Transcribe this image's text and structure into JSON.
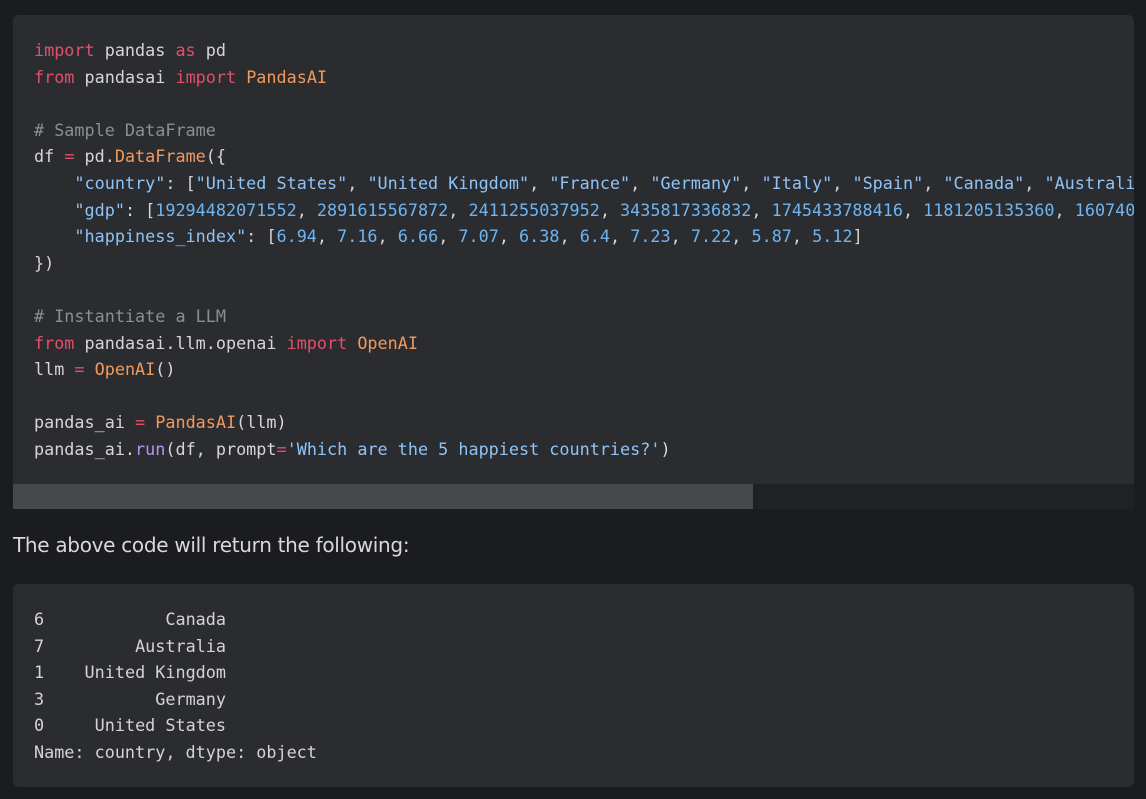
{
  "code": {
    "lines": [
      [
        {
          "t": "import",
          "c": "kw"
        },
        {
          "t": " pandas ",
          "c": "p"
        },
        {
          "t": "as",
          "c": "kw"
        },
        {
          "t": " pd",
          "c": "p"
        }
      ],
      [
        {
          "t": "from",
          "c": "kw"
        },
        {
          "t": " pandasai ",
          "c": "p"
        },
        {
          "t": "import",
          "c": "kw"
        },
        {
          "t": " ",
          "c": "p"
        },
        {
          "t": "PandasAI",
          "c": "cls"
        }
      ],
      [],
      [
        {
          "t": "# Sample DataFrame",
          "c": "com"
        }
      ],
      [
        {
          "t": "df ",
          "c": "p"
        },
        {
          "t": "=",
          "c": "op"
        },
        {
          "t": " pd.",
          "c": "p"
        },
        {
          "t": "DataFrame",
          "c": "cls"
        },
        {
          "t": "({",
          "c": "p"
        }
      ],
      [
        {
          "t": "    \"country\"",
          "c": "str"
        },
        {
          "t": ": [",
          "c": "p"
        },
        {
          "t": "\"United States\"",
          "c": "str"
        },
        {
          "t": ", ",
          "c": "p"
        },
        {
          "t": "\"United Kingdom\"",
          "c": "str"
        },
        {
          "t": ", ",
          "c": "p"
        },
        {
          "t": "\"France\"",
          "c": "str"
        },
        {
          "t": ", ",
          "c": "p"
        },
        {
          "t": "\"Germany\"",
          "c": "str"
        },
        {
          "t": ", ",
          "c": "p"
        },
        {
          "t": "\"Italy\"",
          "c": "str"
        },
        {
          "t": ", ",
          "c": "p"
        },
        {
          "t": "\"Spain\"",
          "c": "str"
        },
        {
          "t": ", ",
          "c": "p"
        },
        {
          "t": "\"Canada\"",
          "c": "str"
        },
        {
          "t": ", ",
          "c": "p"
        },
        {
          "t": "\"Australi",
          "c": "str"
        }
      ],
      [
        {
          "t": "    \"gdp\"",
          "c": "str"
        },
        {
          "t": ": [",
          "c": "p"
        },
        {
          "t": "19294482071552",
          "c": "num"
        },
        {
          "t": ", ",
          "c": "p"
        },
        {
          "t": "2891615567872",
          "c": "num"
        },
        {
          "t": ", ",
          "c": "p"
        },
        {
          "t": "2411255037952",
          "c": "num"
        },
        {
          "t": ", ",
          "c": "p"
        },
        {
          "t": "3435817336832",
          "c": "num"
        },
        {
          "t": ", ",
          "c": "p"
        },
        {
          "t": "1745433788416",
          "c": "num"
        },
        {
          "t": ", ",
          "c": "p"
        },
        {
          "t": "1181205135360",
          "c": "num"
        },
        {
          "t": ", ",
          "c": "p"
        },
        {
          "t": "160740",
          "c": "num"
        }
      ],
      [
        {
          "t": "    \"happiness_index\"",
          "c": "str"
        },
        {
          "t": ": [",
          "c": "p"
        },
        {
          "t": "6.94",
          "c": "num"
        },
        {
          "t": ", ",
          "c": "p"
        },
        {
          "t": "7.16",
          "c": "num"
        },
        {
          "t": ", ",
          "c": "p"
        },
        {
          "t": "6.66",
          "c": "num"
        },
        {
          "t": ", ",
          "c": "p"
        },
        {
          "t": "7.07",
          "c": "num"
        },
        {
          "t": ", ",
          "c": "p"
        },
        {
          "t": "6.38",
          "c": "num"
        },
        {
          "t": ", ",
          "c": "p"
        },
        {
          "t": "6.4",
          "c": "num"
        },
        {
          "t": ", ",
          "c": "p"
        },
        {
          "t": "7.23",
          "c": "num"
        },
        {
          "t": ", ",
          "c": "p"
        },
        {
          "t": "7.22",
          "c": "num"
        },
        {
          "t": ", ",
          "c": "p"
        },
        {
          "t": "5.87",
          "c": "num"
        },
        {
          "t": ", ",
          "c": "p"
        },
        {
          "t": "5.12",
          "c": "num"
        },
        {
          "t": "]",
          "c": "p"
        }
      ],
      [
        {
          "t": "})",
          "c": "p"
        }
      ],
      [],
      [
        {
          "t": "# Instantiate a LLM",
          "c": "com"
        }
      ],
      [
        {
          "t": "from",
          "c": "kw"
        },
        {
          "t": " pandasai.llm.openai ",
          "c": "p"
        },
        {
          "t": "import",
          "c": "kw"
        },
        {
          "t": " ",
          "c": "p"
        },
        {
          "t": "OpenAI",
          "c": "cls"
        }
      ],
      [
        {
          "t": "llm ",
          "c": "p"
        },
        {
          "t": "=",
          "c": "op"
        },
        {
          "t": " ",
          "c": "p"
        },
        {
          "t": "OpenAI",
          "c": "cls"
        },
        {
          "t": "()",
          "c": "p"
        }
      ],
      [],
      [
        {
          "t": "pandas_ai ",
          "c": "p"
        },
        {
          "t": "=",
          "c": "op"
        },
        {
          "t": " ",
          "c": "p"
        },
        {
          "t": "PandasAI",
          "c": "cls"
        },
        {
          "t": "(llm)",
          "c": "p"
        }
      ],
      [
        {
          "t": "pandas_ai.",
          "c": "p"
        },
        {
          "t": "run",
          "c": "fn"
        },
        {
          "t": "(df, prompt",
          "c": "p"
        },
        {
          "t": "=",
          "c": "op"
        },
        {
          "t": "'Which are the 5 happiest countries?'",
          "c": "str"
        },
        {
          "t": ")",
          "c": "p"
        }
      ]
    ],
    "scroll_fraction_visible": 0.66
  },
  "caption": "The above code will return the following:",
  "output": {
    "rows": [
      {
        "index": "6",
        "value": "Canada"
      },
      {
        "index": "7",
        "value": "Australia"
      },
      {
        "index": "1",
        "value": "United Kingdom"
      },
      {
        "index": "3",
        "value": "Germany"
      },
      {
        "index": "0",
        "value": "United States"
      }
    ],
    "footer": "Name: country, dtype: object"
  },
  "colors": {
    "background": "#1b1c1f",
    "block": "#2b2c30",
    "keyword": "#e0506a",
    "class": "#f29a5d",
    "comment": "#8a8f95",
    "string": "#8ec3f6",
    "number": "#6fb4f0",
    "function": "#b694f2"
  }
}
